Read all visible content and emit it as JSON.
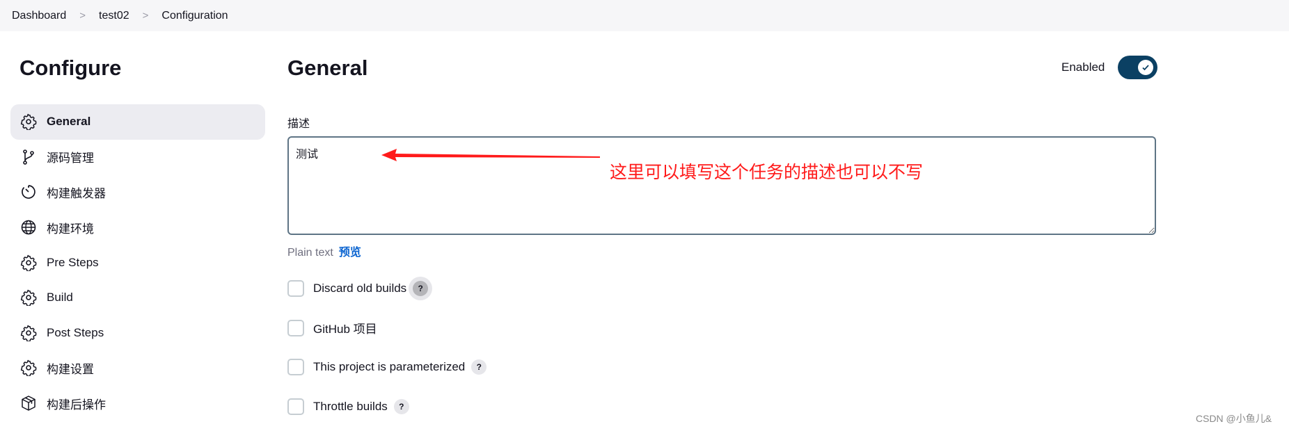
{
  "breadcrumb": [
    "Dashboard",
    "test02",
    "Configuration"
  ],
  "sidebar": {
    "title": "Configure",
    "items": [
      {
        "label": "General",
        "icon": "gear-icon",
        "active": true
      },
      {
        "label": "源码管理",
        "icon": "branch-icon"
      },
      {
        "label": "构建触发器",
        "icon": "timer-icon"
      },
      {
        "label": "构建环境",
        "icon": "globe-icon"
      },
      {
        "label": "Pre Steps",
        "icon": "gear-icon"
      },
      {
        "label": "Build",
        "icon": "gear-icon"
      },
      {
        "label": "Post Steps",
        "icon": "gear-icon"
      },
      {
        "label": "构建设置",
        "icon": "gear-icon"
      },
      {
        "label": "构建后操作",
        "icon": "package-icon"
      }
    ]
  },
  "main": {
    "title": "General",
    "enabled_label": "Enabled",
    "enabled": true,
    "description_label": "描述",
    "description_value": "测试",
    "format_label": "Plain text",
    "preview_link": "预览",
    "options": [
      {
        "label": "Discard old builds",
        "checked": false,
        "help": "?"
      },
      {
        "label": "GitHub 项目",
        "checked": false
      },
      {
        "label": "This project is parameterized",
        "checked": false,
        "help": "?"
      },
      {
        "label": "Throttle builds",
        "checked": false,
        "help": "?"
      }
    ]
  },
  "annotation": {
    "text": "这里可以填写这个任务的描述也可以不写",
    "color": "#ff1a1a"
  },
  "watermark": "CSDN @小鱼儿&",
  "colors": {
    "accent": "#0b4063",
    "link": "#0b64d0"
  }
}
